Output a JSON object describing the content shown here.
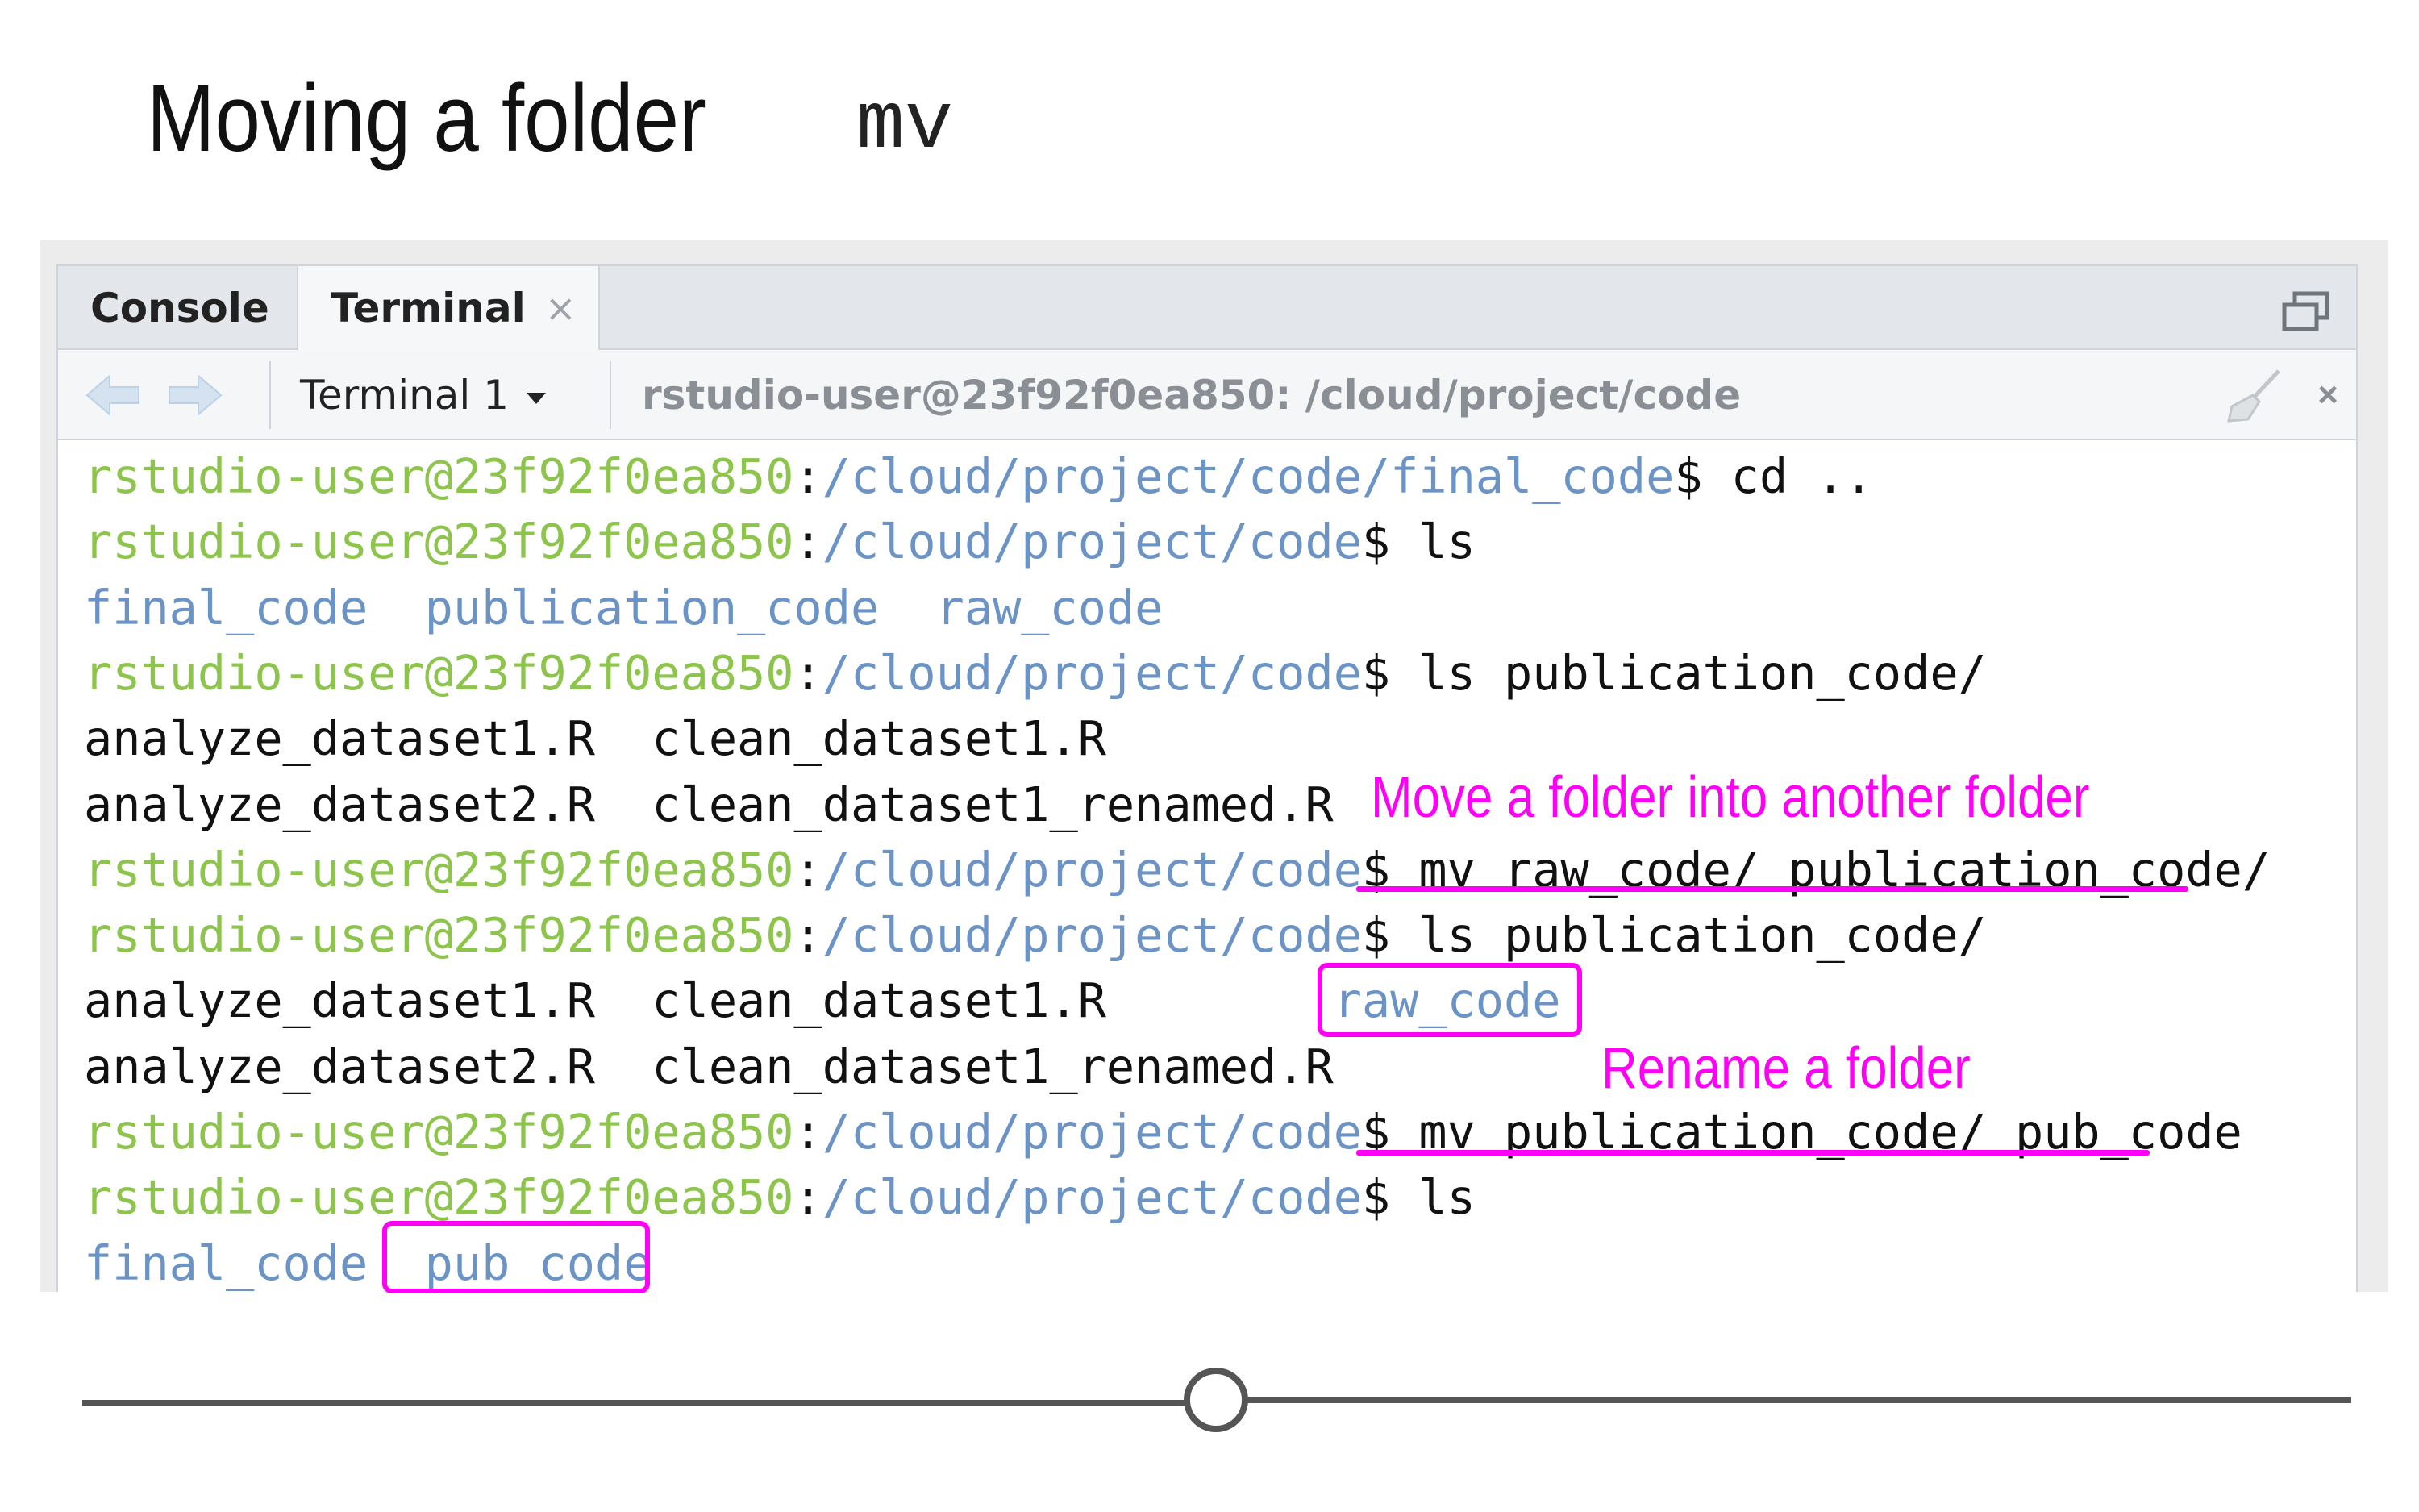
{
  "slide": {
    "title": "Moving a folder",
    "command": "mv"
  },
  "tabs": {
    "console": "Console",
    "terminal": "Terminal",
    "terminal_close": "×"
  },
  "toolbar": {
    "terminal_select": "Terminal 1",
    "terminal_path": "rstudio-user@23f92f0ea850: /cloud/project/code",
    "close": "×"
  },
  "prompt": {
    "user": "rstudio-user@23f92f0ea850",
    "colon": ":",
    "dollar": "$"
  },
  "terminal_lines": [
    {
      "type": "prompt",
      "path": "/cloud/project/code/final_code",
      "cmd": " cd .."
    },
    {
      "type": "prompt",
      "path": "/cloud/project/code",
      "cmd": " ls"
    },
    {
      "type": "dirs",
      "items": [
        "final_code",
        "publication_code",
        "raw_code"
      ]
    },
    {
      "type": "prompt",
      "path": "/cloud/project/code",
      "cmd": " ls publication_code/"
    },
    {
      "type": "output",
      "text": "analyze_dataset1.R  clean_dataset1.R"
    },
    {
      "type": "output",
      "text": "analyze_dataset2.R  clean_dataset1_renamed.R"
    },
    {
      "type": "prompt",
      "path": "/cloud/project/code",
      "cmd": " mv raw_code/ publication_code/"
    },
    {
      "type": "prompt",
      "path": "/cloud/project/code",
      "cmd": " ls publication_code/"
    },
    {
      "type": "output_dir",
      "text": "analyze_dataset1.R  clean_dataset1.R        ",
      "dir": "raw_code"
    },
    {
      "type": "output",
      "text": "analyze_dataset2.R  clean_dataset1_renamed.R"
    },
    {
      "type": "prompt",
      "path": "/cloud/project/code",
      "cmd": " mv publication_code/ pub_code"
    },
    {
      "type": "prompt",
      "path": "/cloud/project/code",
      "cmd": " ls"
    },
    {
      "type": "dirs",
      "items": [
        "final_code",
        "pub_code"
      ]
    }
  ],
  "annotations": {
    "move_into": "Move a folder into another folder",
    "rename": "Rename a folder"
  },
  "colors": {
    "prompt_user": "#8dc44b",
    "prompt_path": "#6b93c6",
    "annotation": "#ff00f7"
  },
  "icons": [
    "back-arrow-icon",
    "forward-arrow-icon",
    "caret-down-icon",
    "broom-icon",
    "maximize-icon",
    "close-icon"
  ]
}
